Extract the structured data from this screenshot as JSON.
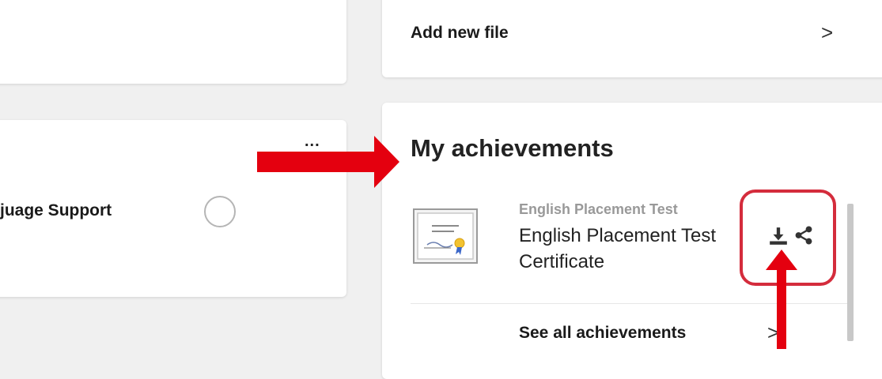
{
  "left_panel": {
    "top_card": {},
    "task_card": {
      "label": "juage Support",
      "menu_glyph": "..."
    }
  },
  "add_file": {
    "label": "Add new file",
    "chevron": ">"
  },
  "achievements": {
    "title": "My achievements",
    "items": [
      {
        "course": "English Placement Test",
        "name": "English Placement Test Certificate",
        "icons": [
          "download-icon",
          "share-icon"
        ]
      }
    ],
    "see_all_label": "See all achievements",
    "chevron": ">"
  },
  "annotations": {
    "color": "#e4000f",
    "highlight_color": "#d42c3c"
  }
}
